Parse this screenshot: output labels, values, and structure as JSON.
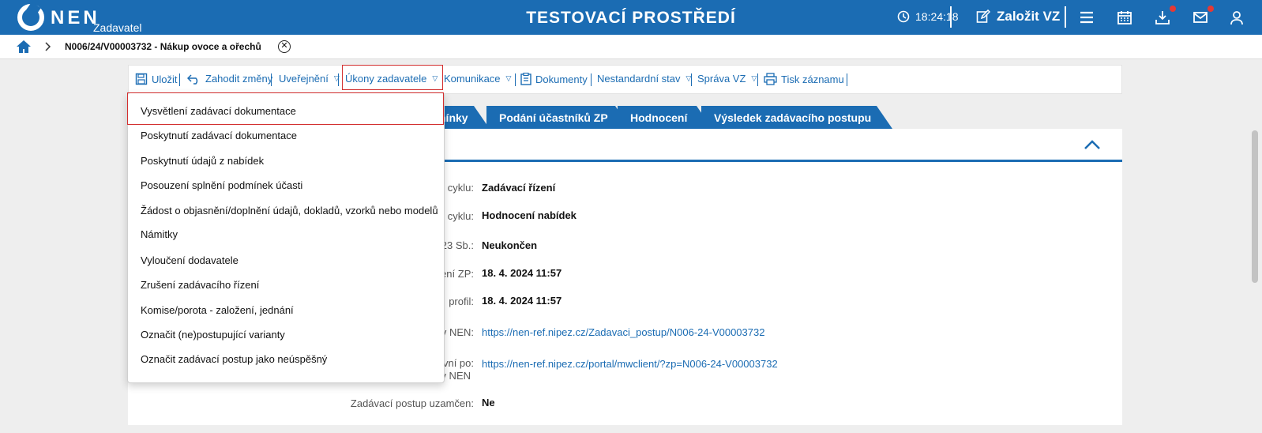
{
  "header": {
    "logo_text": "NEN",
    "logo_sub": "Zadavatel",
    "env_title": "TESTOVACÍ PROSTŘEDÍ",
    "time": "18:24:18",
    "create_label": "Založit VZ",
    "icons": [
      "clock-icon",
      "edit-icon",
      "menu-icon",
      "calendar-icon",
      "download-icon",
      "mail-icon",
      "user-icon"
    ],
    "accent_color": "#1b6cb3",
    "notification_color": "#e53935"
  },
  "breadcrumb": {
    "title": "N006/24/V00003732 - Nákup ovoce a ořechů",
    "close": "✕"
  },
  "toolbar": {
    "save": "Uložit",
    "discard": "Zahodit změny",
    "publish": "Uveřejnění",
    "actions": "Úkony zadavatele",
    "communication": "Komunikace",
    "documents": "Dokumenty",
    "nonstandard": "Nestandardní stav",
    "management": "Správa VZ",
    "print": "Tisk záznamu",
    "arrow": "▽"
  },
  "tabs": [
    "nínky",
    "Podání účastníků ZP",
    "Hodnocení",
    "Výsledek zadávacího postupu"
  ],
  "details": [
    {
      "label": "cyklu:",
      "value": "Zadávací řízení"
    },
    {
      "label": "cyklu:",
      "value": "Hodnocení nabídek"
    },
    {
      "label": "23 Sb.:",
      "value": "Neukončen"
    },
    {
      "label": "ení ZP:",
      "value": "18. 4. 2024 11:57"
    },
    {
      "label": "profil:",
      "value": "18. 4. 2024 11:57"
    },
    {
      "label": "v NEN:",
      "value": "https://nen-ref.nipez.cz/Zadavaci_postup/N006-24-V00003732"
    },
    {
      "label_line1": "vní po:",
      "label_line2": "v NEN",
      "value": "https://nen-ref.nipez.cz/portal/mwclient/?zp=N006-24-V00003732"
    },
    {
      "label": "Zadávací postup uzamčen:",
      "value": "Ne"
    }
  ],
  "menu": {
    "items": [
      "Vysvětlení zadávací dokumentace",
      "Poskytnutí zadávací dokumentace",
      "Poskytnutí údajů z nabídek",
      "Posouzení splnění podmínek účasti",
      "Žádost o objasnění/doplnění údajů, dokladů, vzorků nebo modelů",
      "Námitky",
      "Vyloučení dodavatele",
      "Zrušení zadávacího řízení",
      "Komise/porota - založení, jednání",
      "Označit (ne)postupující varianty",
      "Označit zadávací postup jako neúspěšný"
    ]
  }
}
